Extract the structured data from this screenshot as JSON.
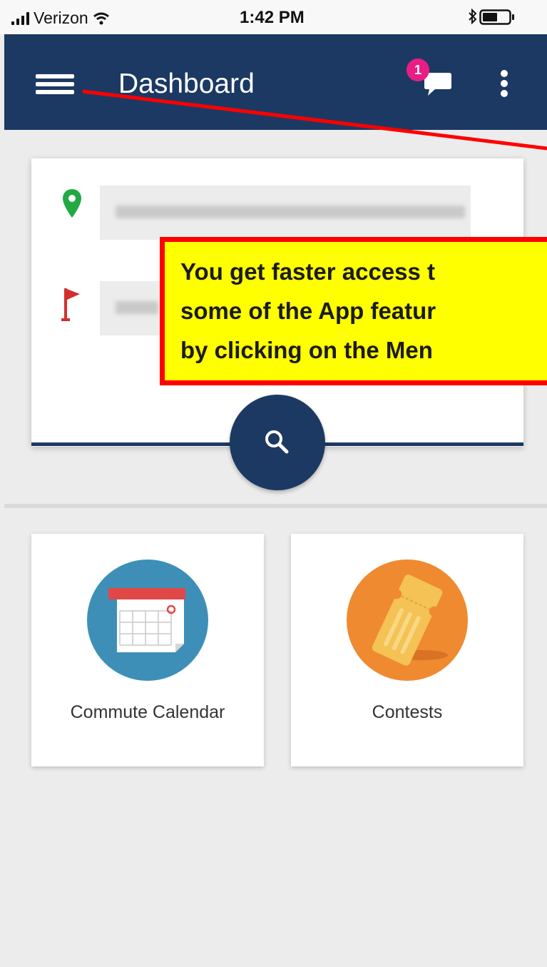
{
  "status_bar": {
    "carrier": "Verizon",
    "time": "1:42 PM",
    "icons": [
      "signal-icon",
      "wifi-icon",
      "bluetooth-icon",
      "battery-icon"
    ]
  },
  "header": {
    "title": "Dashboard",
    "notification_count": "1",
    "background_color": "#1c3963",
    "badge_color": "#e91e84"
  },
  "search_card": {
    "origin_icon": "map-pin-icon",
    "destination_icon": "flag-icon",
    "origin_pin_color": "#21a944",
    "destination_flag_color": "#d32f2f"
  },
  "tiles": [
    {
      "label": "Commute Calendar",
      "icon": "calendar-icon",
      "color": "#3e8fb8"
    },
    {
      "label": "Contests",
      "icon": "ticket-icon",
      "color": "#ef8a30"
    }
  ],
  "annotation": {
    "lines": [
      "You get faster access t",
      "some of the App featur",
      "by clicking on the Men"
    ],
    "highlight_color": "#ffff00",
    "border_color": "#ff0000"
  }
}
